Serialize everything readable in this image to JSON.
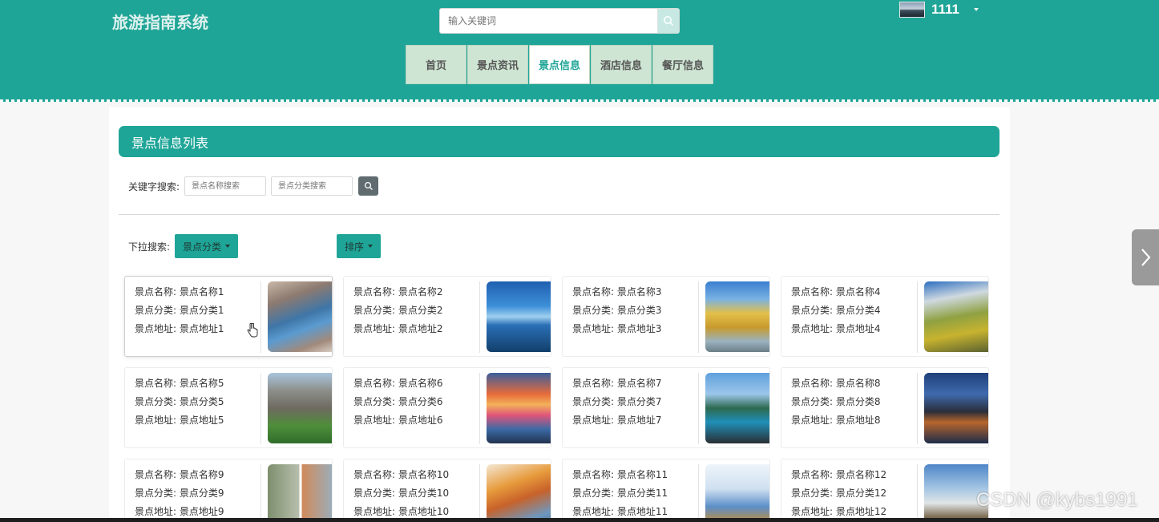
{
  "header": {
    "site_title": "旅游指南系统",
    "search_placeholder": "输入关键词",
    "username": "1111"
  },
  "nav": [
    {
      "label": "首页",
      "active": false
    },
    {
      "label": "景点资讯",
      "active": false
    },
    {
      "label": "景点信息",
      "active": true
    },
    {
      "label": "酒店信息",
      "active": false
    },
    {
      "label": "餐厅信息",
      "active": false
    }
  ],
  "list": {
    "title": "景点信息列表",
    "keyword_label": "关键字搜索:",
    "name_search_placeholder": "景点名称搜索",
    "category_search_placeholder": "景点分类搜索",
    "dropdown_label": "下拉搜索:",
    "category_dropdown": "景点分类",
    "sort_dropdown": "排序"
  },
  "cards": [
    {
      "name": "景点名称: 景点名称1",
      "category": "景点分类: 景点分类1",
      "address": "景点地址: 景点地址1"
    },
    {
      "name": "景点名称: 景点名称2",
      "category": "景点分类: 景点分类2",
      "address": "景点地址: 景点地址2"
    },
    {
      "name": "景点名称: 景点名称3",
      "category": "景点分类: 景点分类3",
      "address": "景点地址: 景点地址3"
    },
    {
      "name": "景点名称: 景点名称4",
      "category": "景点分类: 景点分类4",
      "address": "景点地址: 景点地址4"
    },
    {
      "name": "景点名称: 景点名称5",
      "category": "景点分类: 景点分类5",
      "address": "景点地址: 景点地址5"
    },
    {
      "name": "景点名称: 景点名称6",
      "category": "景点分类: 景点分类6",
      "address": "景点地址: 景点地址6"
    },
    {
      "name": "景点名称: 景点名称7",
      "category": "景点分类: 景点分类7",
      "address": "景点地址: 景点地址7"
    },
    {
      "name": "景点名称: 景点名称8",
      "category": "景点分类: 景点分类8",
      "address": "景点地址: 景点地址8"
    },
    {
      "name": "景点名称: 景点名称9",
      "category": "景点分类: 景点分类9",
      "address": "景点地址: 景点地址9"
    },
    {
      "name": "景点名称: 景点名称10",
      "category": "景点分类: 景点分类10",
      "address": "景点地址: 景点地址10"
    },
    {
      "name": "景点名称: 景点名称11",
      "category": "景点分类: 景点分类11",
      "address": "景点地址: 景点地址11"
    },
    {
      "name": "景点名称: 景点名称12",
      "category": "景点分类: 景点分类12",
      "address": "景点地址: 景点地址12"
    }
  ],
  "watermark": "CSDN @kybs1991",
  "colors": {
    "primary": "#1fa597",
    "nav_bg": "#cfe5d3"
  }
}
